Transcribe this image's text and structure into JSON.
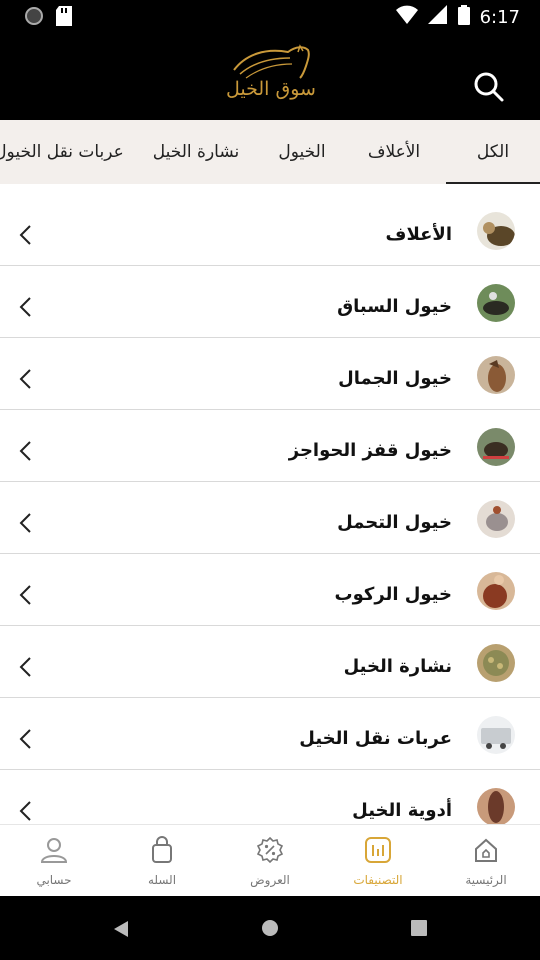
{
  "status_bar": {
    "time": "6:17",
    "icons": [
      "notification-dot-icon",
      "sd-card-icon",
      "wifi-icon",
      "signal-icon",
      "battery-icon"
    ]
  },
  "header": {
    "logo_text": "سوق الخيل",
    "logo_color": "#c9993a",
    "search_icon": "search-icon"
  },
  "tabs": [
    {
      "label": "الكل",
      "active": true
    },
    {
      "label": "الأعلاف",
      "active": false
    },
    {
      "label": "الخيول",
      "active": false
    },
    {
      "label": "نشارة الخيل",
      "active": false
    },
    {
      "label": "عربات نقل الخيول",
      "active": false
    }
  ],
  "categories": [
    {
      "label": "الأعلاف",
      "thumb_color": "#6d5a3a"
    },
    {
      "label": "خيول السباق",
      "thumb_color": "#2e4a2a"
    },
    {
      "label": "خيول الجمال",
      "thumb_color": "#8a6a48"
    },
    {
      "label": "خيول قفز الحواجز",
      "thumb_color": "#4c5a3a"
    },
    {
      "label": "خيول التحمل",
      "thumb_color": "#b39a86"
    },
    {
      "label": "خيول الركوب",
      "thumb_color": "#9a5a3a"
    },
    {
      "label": "نشارة الخيل",
      "thumb_color": "#8c8a55"
    },
    {
      "label": "عربات نقل الخيل",
      "thumb_color": "#c8ccd0"
    },
    {
      "label": "أدوية الخيل",
      "thumb_color": "#8b5a44"
    }
  ],
  "bottom_nav": [
    {
      "label": "الرئيسية",
      "icon": "home-icon",
      "active": false
    },
    {
      "label": "التصنيفات",
      "icon": "categories-icon",
      "active": true
    },
    {
      "label": "العروض",
      "icon": "offers-icon",
      "active": false
    },
    {
      "label": "السله",
      "icon": "cart-icon",
      "active": false
    },
    {
      "label": "حسابي",
      "icon": "account-icon",
      "active": false
    }
  ],
  "colors": {
    "accent": "#d8a637",
    "header_bg": "#000000",
    "tabs_bg": "#f3efec"
  }
}
